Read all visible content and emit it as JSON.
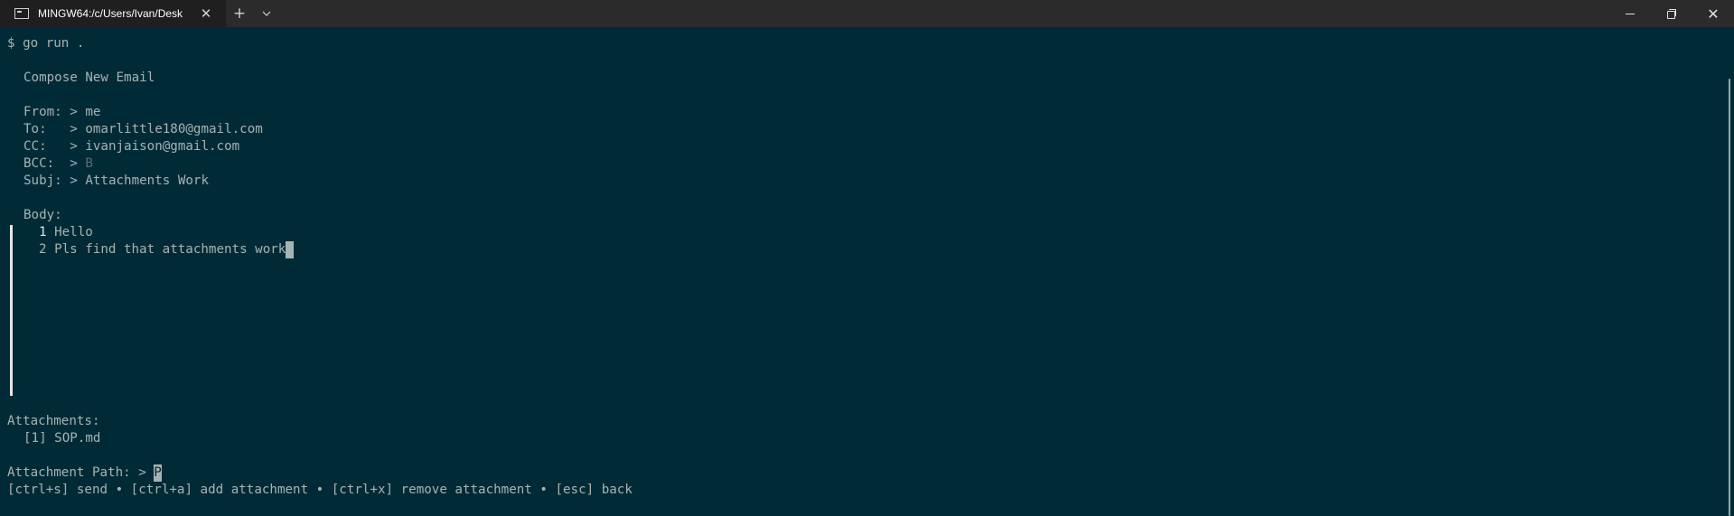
{
  "titlebar": {
    "tab_title": "MINGW64:/c/Users/Ivan/Desk",
    "new_tab": "+",
    "dropdown": "⌄"
  },
  "terminal": {
    "command_line": "$ go run .",
    "heading": "Compose New Email",
    "fields": {
      "from": {
        "label": "From: > ",
        "value": "me"
      },
      "to": {
        "label": "To:   > ",
        "value": "omarlittle180@gmail.com"
      },
      "cc": {
        "label": "CC:   > ",
        "value": "ivanjaison@gmail.com"
      },
      "bcc": {
        "label": "BCC:  > ",
        "placeholder": "B"
      },
      "subj": {
        "label": "Subj: > ",
        "value": "Attachments Work"
      }
    },
    "body_label": "Body:",
    "body_lines": [
      {
        "num": "1",
        "text": "Hello"
      },
      {
        "num": "2",
        "text": "Pls find that attachments work"
      }
    ],
    "attachments_label": "Attachments:",
    "attachments": [
      {
        "index": "[1]",
        "name": "SOP.md"
      }
    ],
    "attachment_path": {
      "label": "Attachment Path: > ",
      "placeholder": "P"
    },
    "help_bar": "[ctrl+s] send • [ctrl+a] add attachment • [ctrl+x] remove attachment • [esc] back"
  },
  "colors": {
    "background": "#002b36",
    "text": "#a6b3b3",
    "dim": "#586e75",
    "titlebar": "#2b2b2b"
  }
}
